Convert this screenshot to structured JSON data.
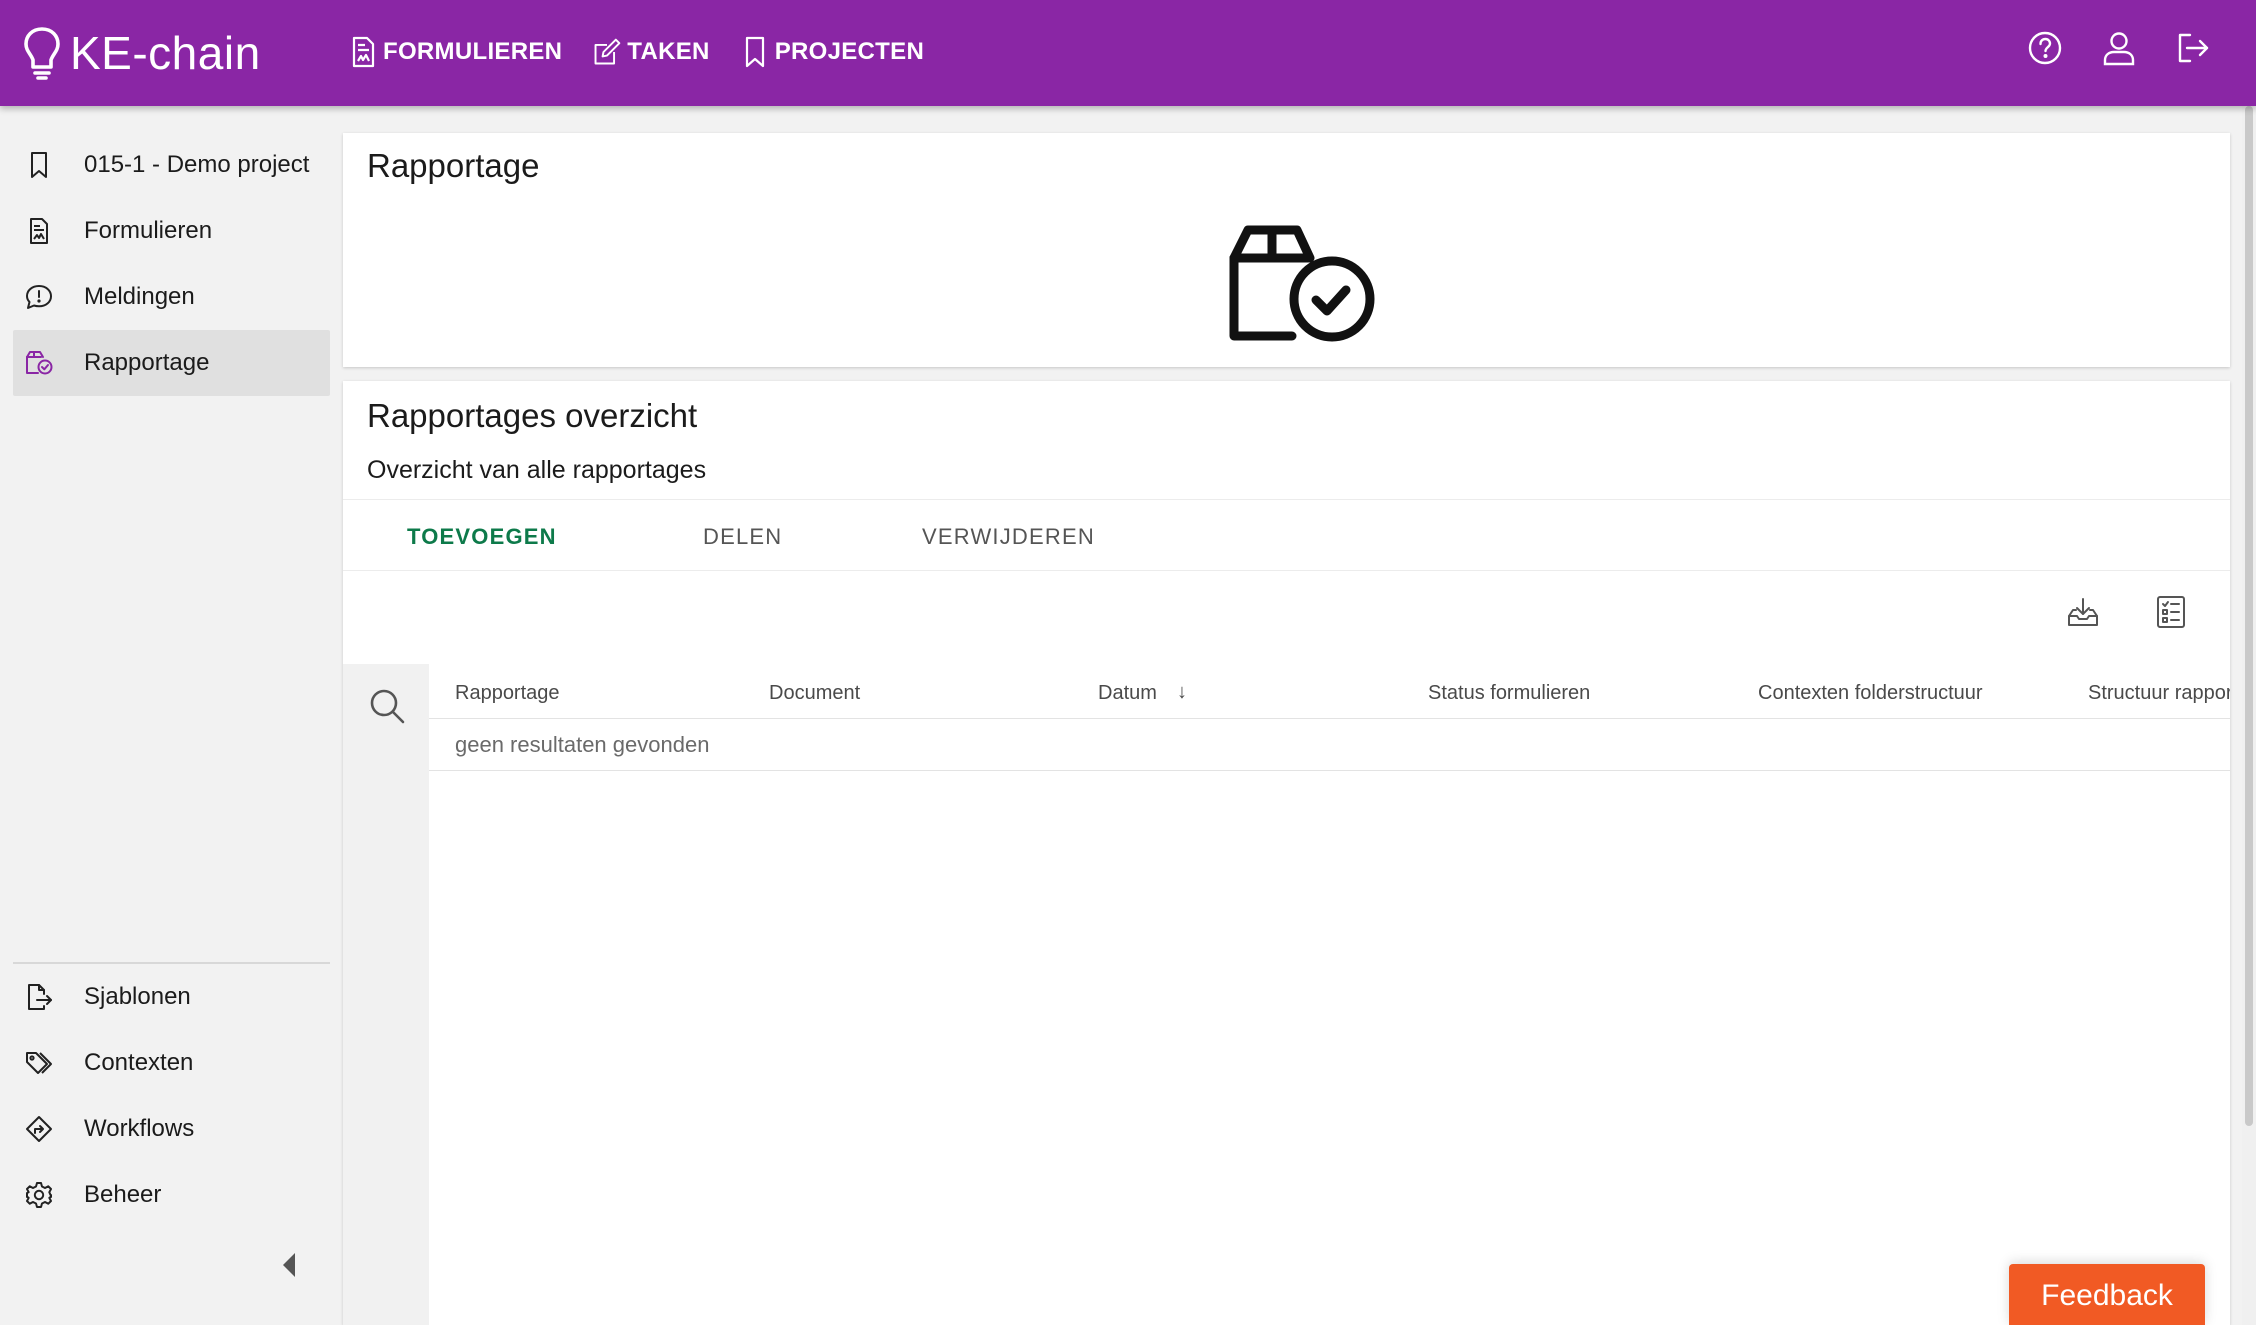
{
  "app": {
    "brand": "KE-chain",
    "nav": [
      {
        "label": "FORMULIEREN",
        "icon": "form-document-icon"
      },
      {
        "label": "TAKEN",
        "icon": "edit-task-icon"
      },
      {
        "label": "PROJECTEN",
        "icon": "bookmark-icon"
      }
    ],
    "top_icons": [
      "help-icon",
      "user-icon",
      "logout-icon"
    ],
    "accent": "#8a26a5"
  },
  "sidebar": {
    "items": [
      {
        "label": "015-1 - Demo project",
        "icon": "bookmark-icon"
      },
      {
        "label": "Formulieren",
        "icon": "form-document-icon"
      },
      {
        "label": "Meldingen",
        "icon": "alert-bubble-icon"
      },
      {
        "label": "Rapportage",
        "icon": "report-box-check-icon",
        "active": true
      }
    ],
    "bottom_items": [
      {
        "label": "Sjablonen",
        "icon": "template-export-icon"
      },
      {
        "label": "Contexten",
        "icon": "tags-icon"
      },
      {
        "label": "Workflows",
        "icon": "workflow-diamond-icon"
      },
      {
        "label": "Beheer",
        "icon": "gear-icon"
      }
    ]
  },
  "hero_card": {
    "title": "Rapportage",
    "icon": "report-box-check-icon"
  },
  "overview": {
    "title": "Rapportages overzicht",
    "subtitle": "Overzicht van alle rapportages",
    "tabs": [
      {
        "label": "TOEVOEGEN",
        "primary": true,
        "color": "#0d7a4a"
      },
      {
        "label": "DELEN"
      },
      {
        "label": "VERWIJDEREN"
      }
    ],
    "toolbar_icons": [
      "download-tray-icon",
      "column-list-icon"
    ],
    "table": {
      "columns": [
        "Rapportage",
        "Document",
        "Datum",
        "Status formulieren",
        "Contexten folderstructuur",
        "Structuur rapportage"
      ],
      "sorted_column": "Datum",
      "sort_indicator": "↓",
      "empty_message": "geen resultaten gevonden"
    }
  },
  "feedback": {
    "label": "Feedback",
    "color": "#f15a24"
  }
}
